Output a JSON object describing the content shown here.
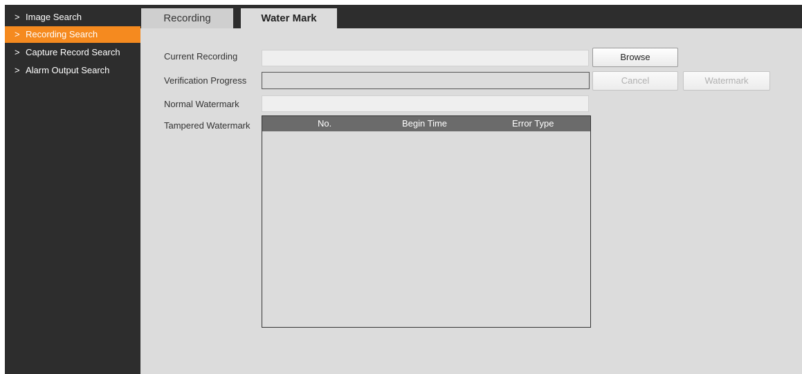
{
  "sidebar": {
    "items": [
      {
        "label": "Image Search",
        "active": false
      },
      {
        "label": "Recording Search",
        "active": true
      },
      {
        "label": "Capture Record Search",
        "active": false
      },
      {
        "label": "Alarm Output Search",
        "active": false
      }
    ]
  },
  "tabs": [
    {
      "label": "Recording",
      "active": false
    },
    {
      "label": "Water Mark",
      "active": true
    }
  ],
  "form": {
    "current_recording_label": "Current Recording",
    "current_recording_value": "",
    "verification_progress_label": "Verification Progress",
    "normal_watermark_label": "Normal Watermark",
    "normal_watermark_value": "",
    "tampered_watermark_label": "Tampered Watermark"
  },
  "buttons": {
    "browse": "Browse",
    "cancel": "Cancel",
    "watermark": "Watermark"
  },
  "table": {
    "columns": [
      "No.",
      "Begin Time",
      "Error Type"
    ],
    "rows": []
  },
  "colors": {
    "accent": "#f58a1f",
    "sidebar_bg": "#2d2d2d",
    "content_bg": "#dcdcdc",
    "table_header_bg": "#6b6b6b"
  }
}
